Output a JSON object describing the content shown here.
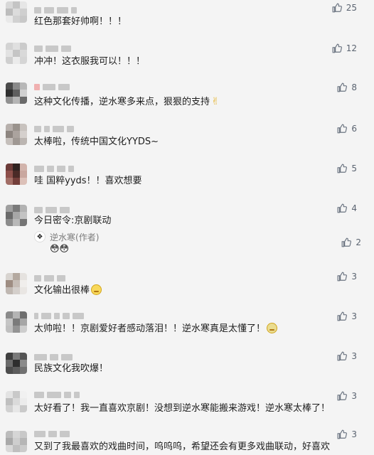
{
  "comments": [
    {
      "text": "红色那套好帅啊！！！",
      "likes": "25"
    },
    {
      "text": "冲冲！这衣服我可以！！！",
      "likes": "12"
    },
    {
      "text": "这种文化传播，逆水寒多来点，狠狠的支持",
      "likes": "8",
      "emoji": "✌"
    },
    {
      "text": "太棒啦，传统中国文化YYDS~",
      "likes": "6"
    },
    {
      "text": "哇 国粹yyds！！喜欢想要",
      "likes": "5"
    },
    {
      "text": "今日密令:京剧联动",
      "likes": "4"
    },
    {
      "text": "文化输出很棒",
      "likes": "3"
    },
    {
      "text": "太帅啦！！京剧爱好者感动落泪！！逆水寒真是太懂了！",
      "likes": "3"
    },
    {
      "text": "民族文化我吹爆！",
      "likes": "3"
    },
    {
      "text": "太好看了！我一直喜欢京剧！没想到逆水寒能搬来游戏！逆水寒太棒了！",
      "likes": "3"
    },
    {
      "text": "又到了我最喜欢的戏曲时间，呜呜呜，希望还会有更多戏曲联动，好喜欢",
      "likes": "3"
    }
  ],
  "reply": {
    "author": "逆水寒",
    "author_tag": "(作者)",
    "likes": "2",
    "emoji": "😳😳"
  },
  "colors": {
    "background": "#f4f4f4",
    "text": "#1e1e1e",
    "muted": "#5a6370",
    "like_icon": "#6a7380"
  },
  "icons": {
    "like": "thumb-up-icon",
    "author_avatar": "author-avatar-icon"
  }
}
